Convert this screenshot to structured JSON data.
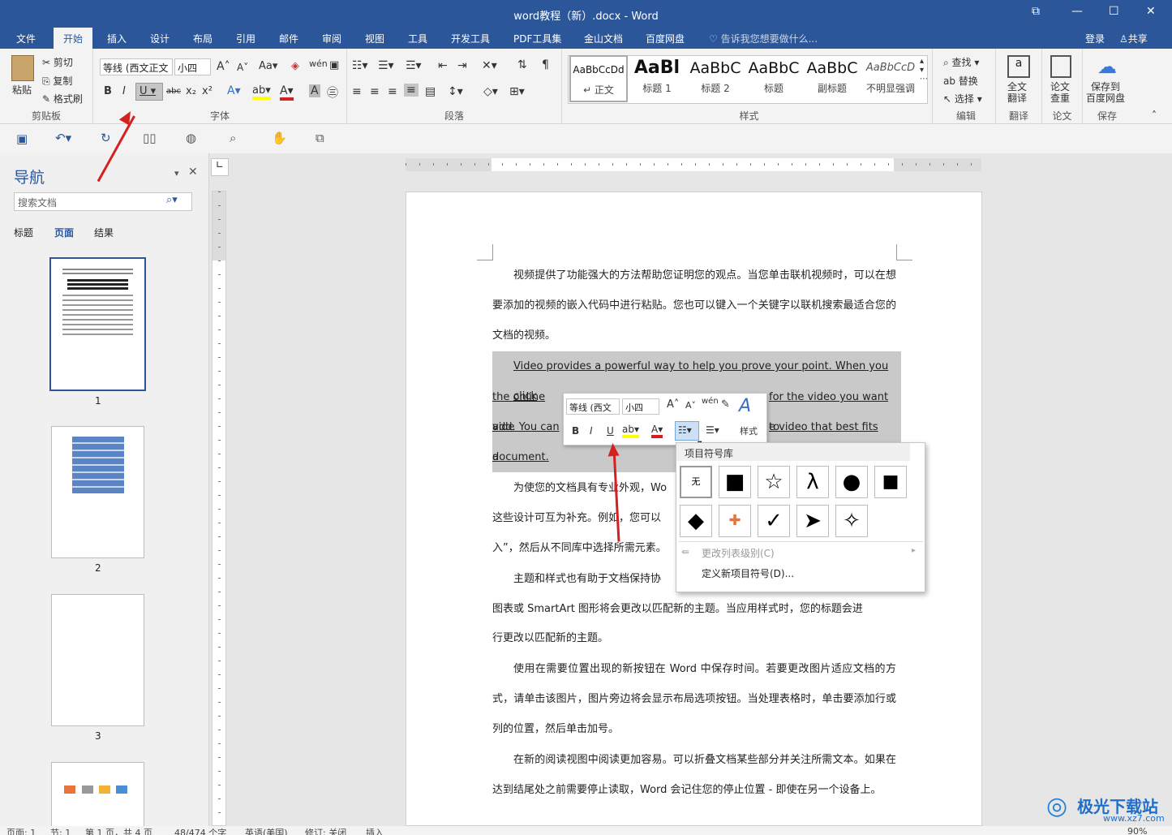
{
  "window": {
    "title": "word教程（新）.docx - Word"
  },
  "tabs": [
    "文件",
    "开始",
    "插入",
    "设计",
    "布局",
    "引用",
    "邮件",
    "审阅",
    "视图",
    "工具",
    "开发工具",
    "PDF工具集",
    "金山文档",
    "百度网盘"
  ],
  "tell_me": "告诉我您想要做什么...",
  "account": {
    "login": "登录",
    "share": "共享"
  },
  "ribbon": {
    "clipboard": {
      "paste": "粘贴",
      "cut": "剪切",
      "copy": "复制",
      "format_painter": "格式刷",
      "label": "剪贴板"
    },
    "font": {
      "font_name": "等线 (西文正文",
      "font_size": "小四",
      "label": "字体"
    },
    "paragraph": {
      "label": "段落"
    },
    "styles": {
      "items": [
        {
          "preview": "AaBbCcDd",
          "name": "↵ 正文"
        },
        {
          "preview": "AaBl",
          "name": "标题 1"
        },
        {
          "preview": "AaBbC",
          "name": "标题 2"
        },
        {
          "preview": "AaBbC",
          "name": "标题"
        },
        {
          "preview": "AaBbC",
          "name": "副标题"
        },
        {
          "preview": "AaBbCcD",
          "name": "不明显强调"
        }
      ],
      "label": "样式"
    },
    "editing": {
      "find": "查找",
      "replace": "替换",
      "select": "选择",
      "label": "编辑"
    },
    "translate": {
      "full": "全文\n翻译",
      "label": "翻译"
    },
    "paper": {
      "check": "论文\n查重",
      "label": "论文"
    },
    "save": {
      "baidu": "保存到\n百度网盘",
      "label": "保存"
    }
  },
  "nav": {
    "title": "导航",
    "search_placeholder": "搜索文档",
    "tabs": [
      "标题",
      "页面",
      "结果"
    ],
    "pages": [
      "1",
      "2",
      "3"
    ]
  },
  "document": {
    "p1": "视频提供了功能强大的方法帮助您证明您的观点。当您单击联机视频时，可以在想要添加的视频的嵌入代码中进行粘贴。您也可以键入一个关键字以联机搜索最适合您的文档的视频。",
    "p2_l1": "Video provides a powerful way to help you prove your point. When you click",
    "p2_l2a": "the online vide",
    "p2_l2b": "for the video you want to",
    "p2_l3a": "add. You can a",
    "p2_l3b": "e video that best fits your",
    "p2_l4": "document.",
    "p3_l1": "为使您的文档具有专业外观，Wo",
    "p3_l2": "这些设计可互为补充。例如，您可以",
    "p3_l3": "入”，然后从不同库中选择所需元素。",
    "p4_l1": "主题和样式也有助于文档保持协",
    "p4_l2": "图表或 SmartArt 图形将会更改以匹配新的主题。当应用样式时，您的标题会进",
    "p4_l3": "行更改以匹配新的主题。",
    "p5": "使用在需要位置出现的新按钮在 Word 中保存时间。若要更改图片适应文档的方式，请单击该图片，图片旁边将会显示布局选项按钮。当处理表格时，单击要添加行或列的位置，然后单击加号。",
    "p6": "在新的阅读视图中阅读更加容易。可以折叠文档某些部分并关注所需文本。如果在达到结尾处之前需要停止读取，Word 会记住您的停止位置 - 即使在另一个设备上。"
  },
  "mini_toolbar": {
    "font": "等线 (西文",
    "size": "小四",
    "styles": "样式"
  },
  "bullet_library": {
    "title": "项目符号库",
    "none": "无",
    "symbols": [
      "■",
      "☆",
      "λ",
      "●",
      "■",
      "◆",
      "✚",
      "✓",
      "➤",
      "✧"
    ],
    "change_level": "更改列表级别(C)",
    "define_new": "定义新项目符号(D)..."
  },
  "status": {
    "page": "页面: 1",
    "section": "节: 1",
    "pageof": "第 1 页，共 4 页",
    "words": "48/474 个字",
    "lang": "英语(美国)",
    "track": "修订: 关闭",
    "insert": "插入",
    "zoom": "90%"
  },
  "watermark": "极光下载站",
  "watermark_url": "www.xz7.com",
  "colors": {
    "accent": "#2b579a",
    "arrow": "#d42020",
    "highlight": "#c9c9c9"
  }
}
